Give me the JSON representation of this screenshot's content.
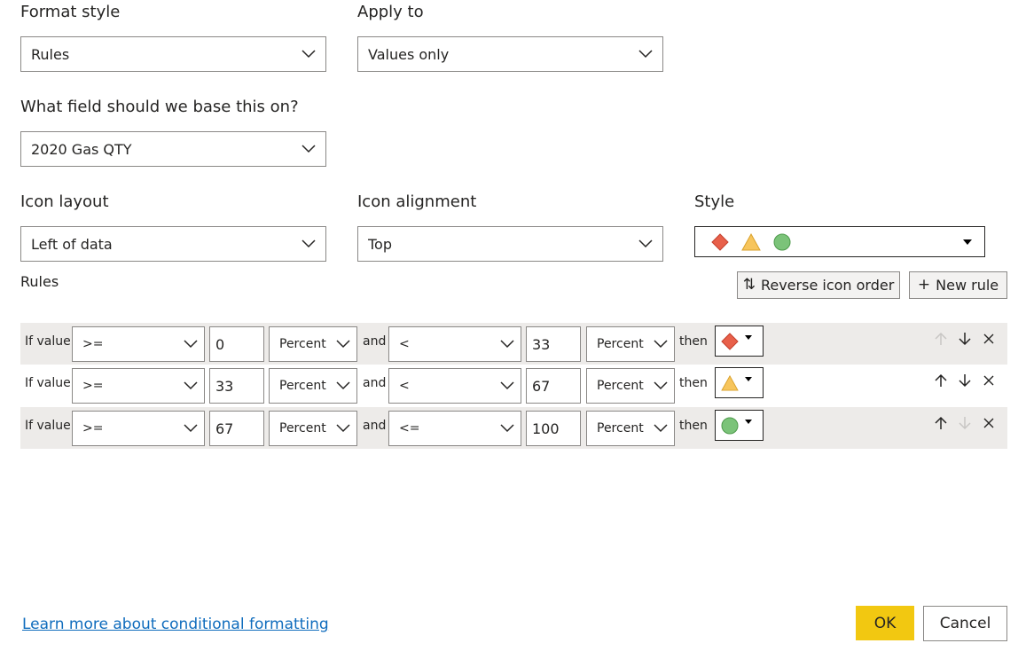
{
  "format_style": {
    "label": "Format style",
    "value": "Rules"
  },
  "apply_to": {
    "label": "Apply to",
    "value": "Values only"
  },
  "base_field": {
    "label": "What field should we base this on?",
    "value": "2020 Gas QTY"
  },
  "icon_layout": {
    "label": "Icon layout",
    "value": "Left of data"
  },
  "icon_alignment": {
    "label": "Icon alignment",
    "value": "Top"
  },
  "style": {
    "label": "Style",
    "icons": [
      "red-diamond-icon",
      "yellow-triangle-icon",
      "green-circle-icon"
    ]
  },
  "rules_label": "Rules",
  "buttons": {
    "reverse_icon_order": "Reverse icon order",
    "new_rule": "New rule"
  },
  "rules": [
    {
      "if_text": "If value",
      "op1": ">=",
      "value1": "0",
      "unit1": "Percent",
      "and_text": "and",
      "op2": "<",
      "value2": "33",
      "unit2": "Percent",
      "then_text": "then",
      "icon": "red-diamond-icon"
    },
    {
      "if_text": "If value",
      "op1": ">=",
      "value1": "33",
      "unit1": "Percent",
      "and_text": "and",
      "op2": "<",
      "value2": "67",
      "unit2": "Percent",
      "then_text": "then",
      "icon": "yellow-triangle-icon"
    },
    {
      "if_text": "If value",
      "op1": ">=",
      "value1": "67",
      "unit1": "Percent",
      "and_text": "and",
      "op2": "<=",
      "value2": "100",
      "unit2": "Percent",
      "then_text": "then",
      "icon": "green-circle-icon"
    }
  ],
  "footer": {
    "learn_more": "Learn more about conditional formatting",
    "ok": "OK",
    "cancel": "Cancel"
  },
  "colors": {
    "accent_ok": "#f2c811",
    "link": "#0f6cbd",
    "red": "#e8604a",
    "yellow": "#f7c55c",
    "green": "#7bc379",
    "row_shade": "#edebe9"
  }
}
